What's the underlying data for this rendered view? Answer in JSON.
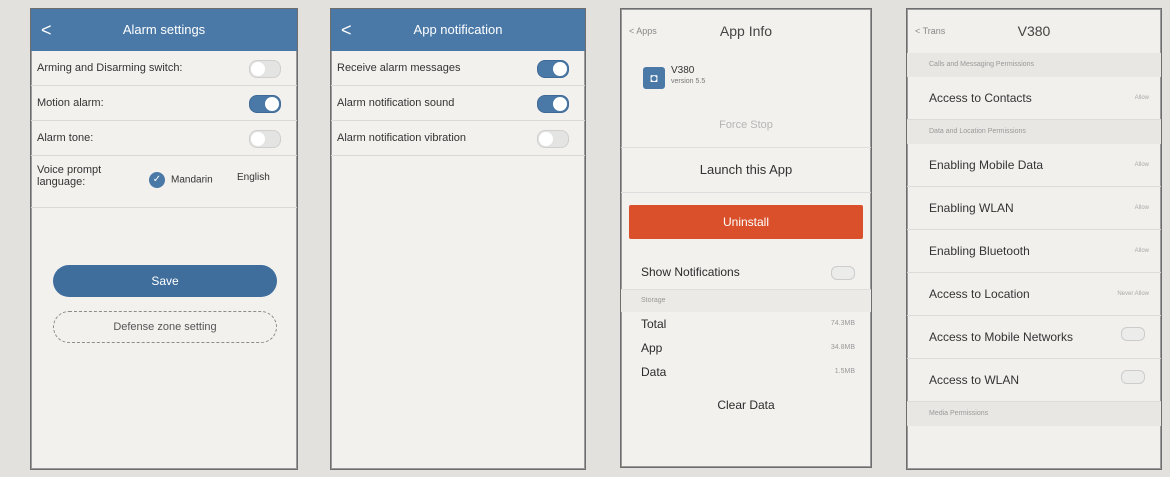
{
  "alarm_settings": {
    "title": "Alarm settings",
    "back": "<",
    "rows": [
      {
        "label": "Arming and Disarming switch:",
        "on": false
      },
      {
        "label": "Motion alarm:",
        "on": true
      },
      {
        "label": "Alarm tone:",
        "on": false
      }
    ],
    "voice_label": "Voice prompt language:",
    "option_selected": "Mandarin",
    "option_other": "English",
    "save": "Save",
    "defense": "Defense zone setting"
  },
  "app_notification": {
    "title": "App notification",
    "back": "<",
    "rows": [
      {
        "label": "Receive alarm messages",
        "on": true
      },
      {
        "label": "Alarm notification sound",
        "on": true
      },
      {
        "label": "Alarm notification vibration",
        "on": false
      }
    ]
  },
  "app_info": {
    "back": "< Apps",
    "title": "App Info",
    "app_name": "V380",
    "version": "version 5.5",
    "force_stop": "Force Stop",
    "launch": "Launch this App",
    "uninstall": "Uninstall",
    "show_notifications": "Show Notifications",
    "storage_label": "Storage",
    "total_label": "Total",
    "total_value": "74.3MB",
    "app_label": "App",
    "app_value": "34.8MB",
    "data_label": "Data",
    "data_value": "1.5MB",
    "clear_data": "Clear Data"
  },
  "permissions": {
    "back": "< Trans",
    "title": "V380",
    "section1": "Calls and Messaging Permissions",
    "contacts": "Access to Contacts",
    "contacts_val": "Allow",
    "section2": "Data and Location Permissions",
    "mobile_data": "Enabling Mobile Data",
    "mobile_data_val": "Allow",
    "wlan": "Enabling WLAN",
    "wlan_val": "Allow",
    "bluetooth": "Enabling Bluetooth",
    "bluetooth_val": "Allow",
    "location": "Access to Location",
    "location_val": "Never Allow",
    "mobile_networks": "Access to Mobile Networks",
    "access_wlan": "Access to WLAN",
    "section3": "Media Permissions"
  }
}
